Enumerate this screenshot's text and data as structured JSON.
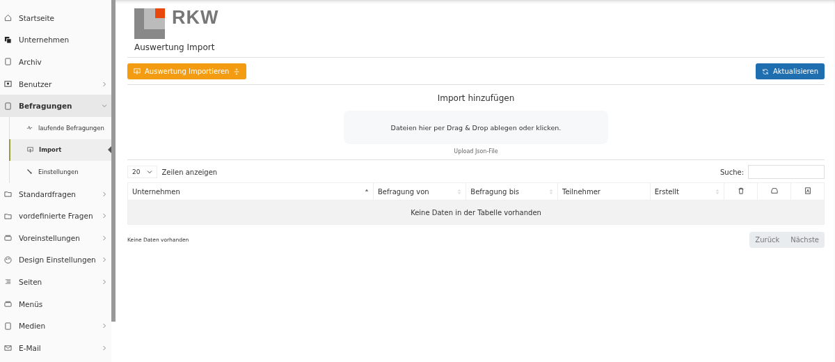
{
  "sidebar": {
    "items": [
      {
        "kind": "link",
        "label": "Startseite",
        "selected": false
      },
      {
        "kind": "link",
        "label": "Unternehmen",
        "selected": false
      },
      {
        "kind": "link",
        "label": "Archiv",
        "selected": false
      },
      {
        "kind": "submenu",
        "label": "Benutzer",
        "expanded": false,
        "selected": false
      },
      {
        "kind": "submenu",
        "label": "Befragungen",
        "expanded": true,
        "selected": true,
        "children": [
          {
            "label": "laufende Befragungen",
            "selected": false
          },
          {
            "label": "Import",
            "selected": true
          },
          {
            "label": "Einstellungen",
            "selected": false
          }
        ]
      },
      {
        "kind": "submenu",
        "label": "Standardfragen",
        "expanded": false,
        "selected": false
      },
      {
        "kind": "submenu",
        "label": "vordefinierte Fragen",
        "expanded": false,
        "selected": false
      },
      {
        "kind": "submenu",
        "label": "Voreinstellungen",
        "expanded": false,
        "selected": false
      },
      {
        "kind": "submenu",
        "label": "Design Einstellungen",
        "expanded": false,
        "selected": false
      },
      {
        "kind": "submenu",
        "label": "Seiten",
        "expanded": false,
        "selected": false
      },
      {
        "kind": "link",
        "label": "Menüs",
        "selected": false
      },
      {
        "kind": "submenu",
        "label": "Medien",
        "expanded": false,
        "selected": false
      },
      {
        "kind": "submenu",
        "label": "E-Mail",
        "expanded": false,
        "selected": false
      }
    ]
  },
  "logo": {
    "text": "RKW"
  },
  "page_title": "Auswertung Import",
  "toolbar": {
    "import_button": "Auswertung Importieren",
    "refresh_button": "Aktualisieren"
  },
  "upload": {
    "heading": "Import hinzufügen",
    "dropzone": "Dateien hier per Drag & Drop ablegen oder klicken.",
    "hint": "Upload Json-File"
  },
  "table": {
    "page_size": "20",
    "page_size_label": "Zeilen anzeigen",
    "search_label": "Suche:",
    "columns": [
      {
        "kind": "text",
        "label": "Unternehmen",
        "sortable": true,
        "sorted": true
      },
      {
        "kind": "text",
        "label": "Befragung von",
        "sortable": true,
        "sorted": false
      },
      {
        "kind": "text",
        "label": "Befragung bis",
        "sortable": true,
        "sorted": false
      },
      {
        "kind": "text",
        "label": "Teilnehmer",
        "sortable": false,
        "sorted": false
      },
      {
        "kind": "text",
        "label": "Erstellt",
        "sortable": true,
        "sorted": false
      },
      {
        "kind": "icon"
      },
      {
        "kind": "icon"
      },
      {
        "kind": "icon"
      }
    ],
    "empty_message": "Keine Daten in der Tabelle vorhanden",
    "info": "Keine Daten vorhanden",
    "prev_button": "Zurück",
    "next_button": "Nächste"
  }
}
